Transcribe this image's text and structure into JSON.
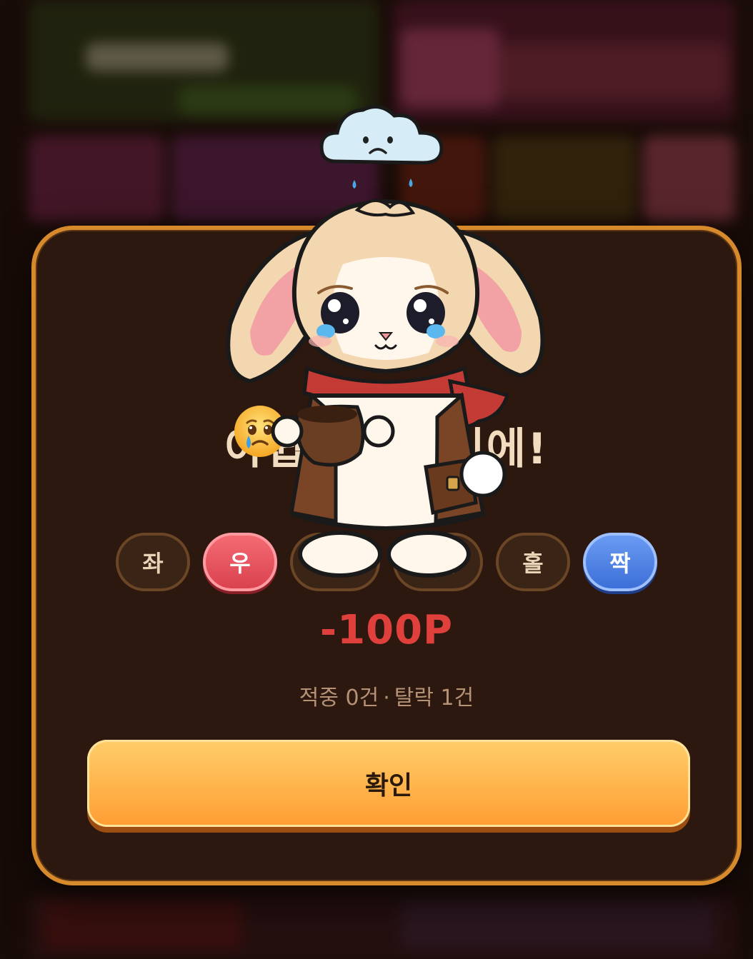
{
  "result": {
    "headline": "아쉽게도 꽝이에!",
    "picks": [
      {
        "label": "좌",
        "state": "off"
      },
      {
        "label": "우",
        "state": "selected-red"
      },
      {
        "label": "3줄",
        "state": "off"
      },
      {
        "label": "4줄",
        "state": "off"
      },
      {
        "label": "홀",
        "state": "off"
      },
      {
        "label": "짝",
        "state": "selected-blue"
      }
    ],
    "amount": "-100P",
    "hits_label": "적중 0건",
    "separator": "·",
    "misses_label": "탈락 1건",
    "confirm_label": "확인"
  },
  "colors": {
    "modal_border": "#d68a2c",
    "loss_amount": "#e0403c",
    "pick_red": "#e14b57",
    "pick_blue": "#4a7ee0",
    "confirm_button": "#ffb347"
  },
  "icons": [
    "crying-face-emoji-icon",
    "sad-rain-cloud-icon",
    "crying-bunny-mascot"
  ]
}
